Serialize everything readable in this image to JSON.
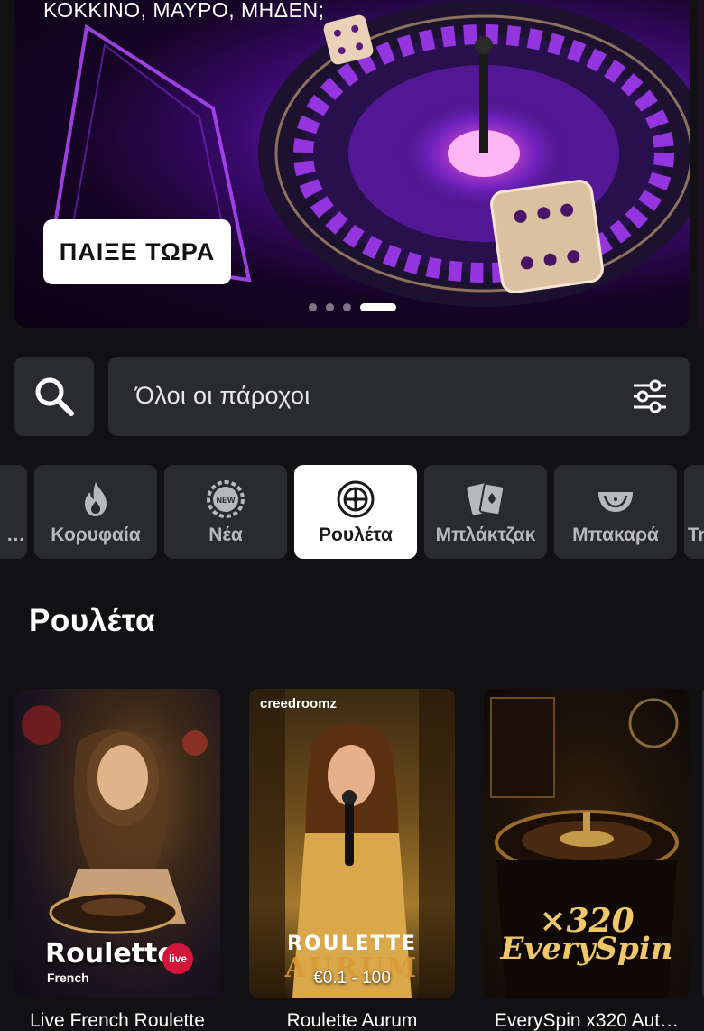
{
  "hero": {
    "title": "ΚΟΚΚΙΝΟ, ΜΑΥΡΟ, ΜΗΔΕΝ;",
    "cta_label": "ΠΑΙΞΕ ΤΩΡΑ",
    "slides_count": 4,
    "active_slide": 4
  },
  "search": {
    "icon": "search-icon",
    "provider_label": "Όλοι οι πάροχοι",
    "filter_icon": "sliders-icon"
  },
  "tabs": [
    {
      "label": "…",
      "icon": "unknown-icon",
      "active": false
    },
    {
      "label": "Κορυφαία",
      "icon": "fire-icon",
      "active": false
    },
    {
      "label": "Νέα",
      "icon": "new-badge-icon",
      "active": false
    },
    {
      "label": "Ρουλέτα",
      "icon": "roulette-icon",
      "active": true
    },
    {
      "label": "Μπλάκτζακ",
      "icon": "cards-icon",
      "active": false
    },
    {
      "label": "Μπακαρά",
      "icon": "baccarat-table-icon",
      "active": false
    },
    {
      "label": "Τη",
      "icon": "unknown-icon",
      "active": false
    }
  ],
  "section": {
    "title": "Ρουλέτα"
  },
  "games": [
    {
      "name": "Live French Roulette",
      "logo": "Roulette",
      "logo_sub": "French",
      "badge": "live"
    },
    {
      "name": "Roulette Aurum",
      "brand": "creedroomz",
      "logo_line1": "ROULETTE",
      "logo_line2": "AURUM",
      "limits": "€0.1 - 100"
    },
    {
      "name": "EverySpin x320 Aut…",
      "logo_line1": "×320",
      "logo_line2": "EverySpin"
    }
  ],
  "colors": {
    "background": "#111113",
    "tile": "#2a2b2e",
    "active_tab": "#ffffff",
    "tab_text": "#b8b9bd",
    "hero_purple": "#7a1fd0"
  }
}
